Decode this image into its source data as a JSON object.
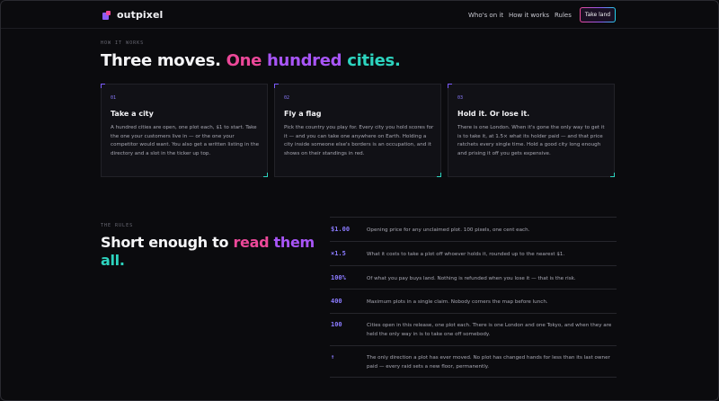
{
  "header": {
    "brand": "outpixel",
    "nav": [
      "Who's on it",
      "How it works",
      "Rules"
    ],
    "cta": "Take land"
  },
  "how": {
    "eyebrow": "HOW IT WORKS",
    "title_a": "Three moves. ",
    "title_b": "One ",
    "title_c": "hundred ",
    "title_d": "cities.",
    "cards": [
      {
        "num": "01",
        "title": "Take a city",
        "body": "A hundred cities are open, one plot each, $1 to start. Take the one your customers live in — or the one your competitor would want. You also get a written listing in the directory and a slot in the ticker up top."
      },
      {
        "num": "02",
        "title": "Fly a flag",
        "body": "Pick the country you play for. Every city you hold scores for it — and you can take one anywhere on Earth. Holding a city inside someone else's borders is an occupation, and it shows on their standings in red."
      },
      {
        "num": "03",
        "title": "Hold it. Or lose it.",
        "body": "There is one London. When it's gone the only way to get it is to take it, at 1.5× what its holder paid — and that price ratchets every single time. Hold a good city long enough and prising it off you gets expensive."
      }
    ]
  },
  "rules": {
    "eyebrow": "THE RULES",
    "title_a": "Short enough to ",
    "title_b": "read ",
    "title_c": "them ",
    "title_d": "all.",
    "items": [
      {
        "key": "$1.00",
        "text": "Opening price for any unclaimed plot. 100 pixels, one cent each."
      },
      {
        "key": "×1.5",
        "text": "What it costs to take a plot off whoever holds it, rounded up to the nearest $1."
      },
      {
        "key": "100%",
        "text": "Of what you pay buys land. Nothing is refunded when you lose it — that is the risk."
      },
      {
        "key": "400",
        "text": "Maximum plots in a single claim. Nobody corners the map before lunch."
      },
      {
        "key": "100",
        "text": "Cities open in this release, one plot each. There is one London and one Tokyo, and when they are held the only way in is to take one off somebody."
      },
      {
        "key": "↑",
        "text": "The only direction a plot has ever moved. No plot has changed hands for less than its last owner paid — every raid sets a new floor, permanently."
      }
    ]
  }
}
